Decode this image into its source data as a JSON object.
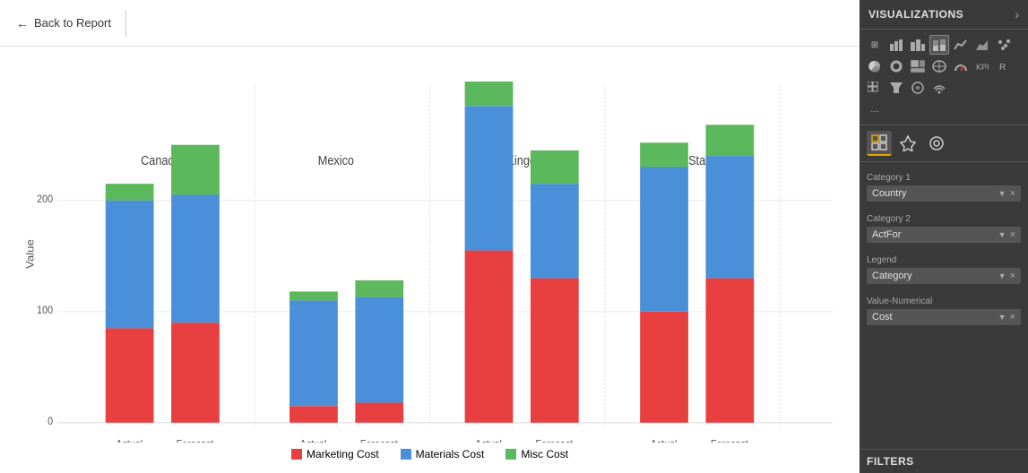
{
  "nav": {
    "back_label": "Back to Report"
  },
  "panel": {
    "title": "VISUALIZATIONS",
    "chevron": "›",
    "tabs": [
      {
        "label": "⊞",
        "icon": "fields-icon",
        "active": true
      },
      {
        "label": "▼",
        "icon": "format-icon",
        "active": false
      },
      {
        "label": "◉",
        "icon": "analytics-icon",
        "active": false
      }
    ],
    "fields": [
      {
        "section_label": "Category 1",
        "pill_text": "Country",
        "has_chevron": true,
        "has_x": true
      },
      {
        "section_label": "Category 2",
        "pill_text": "ActFor",
        "has_chevron": true,
        "has_x": true
      },
      {
        "section_label": "Legend",
        "pill_text": "Category",
        "has_chevron": true,
        "has_x": true
      },
      {
        "section_label": "Value-Numerical",
        "pill_text": "Cost",
        "has_chevron": true,
        "has_x": true
      }
    ],
    "filters_title": "FILTERS"
  },
  "chart": {
    "y_axis_label": "Value",
    "groups": [
      {
        "name": "Canada",
        "bars": [
          {
            "label": "Actual",
            "segments": [
              {
                "color": "#e84040",
                "value": 85
              },
              {
                "color": "#4a90d9",
                "value": 115
              },
              {
                "color": "#5cb85c",
                "value": 15
              }
            ]
          },
          {
            "label": "Forecast",
            "segments": [
              {
                "color": "#e84040",
                "value": 90
              },
              {
                "color": "#4a90d9",
                "value": 115
              },
              {
                "color": "#5cb85c",
                "value": 45
              }
            ]
          }
        ]
      },
      {
        "name": "Mexico",
        "bars": [
          {
            "label": "Actual",
            "segments": [
              {
                "color": "#e84040",
                "value": 15
              },
              {
                "color": "#4a90d9",
                "value": 95
              },
              {
                "color": "#5cb85c",
                "value": 8
              }
            ]
          },
          {
            "label": "Forecast",
            "segments": [
              {
                "color": "#e84040",
                "value": 18
              },
              {
                "color": "#4a90d9",
                "value": 95
              },
              {
                "color": "#5cb85c",
                "value": 15
              }
            ]
          }
        ]
      },
      {
        "name": "United Kingdom",
        "bars": [
          {
            "label": "Actual",
            "segments": [
              {
                "color": "#e84040",
                "value": 155
              },
              {
                "color": "#4a90d9",
                "value": 130
              },
              {
                "color": "#5cb85c",
                "value": 22
              }
            ]
          },
          {
            "label": "Forecast",
            "segments": [
              {
                "color": "#e84040",
                "value": 130
              },
              {
                "color": "#4a90d9",
                "value": 85
              },
              {
                "color": "#5cb85c",
                "value": 30
              }
            ]
          }
        ]
      },
      {
        "name": "United States",
        "bars": [
          {
            "label": "Actual",
            "segments": [
              {
                "color": "#e84040",
                "value": 100
              },
              {
                "color": "#4a90d9",
                "value": 130
              },
              {
                "color": "#5cb85c",
                "value": 22
              }
            ]
          },
          {
            "label": "Forecast",
            "segments": [
              {
                "color": "#e84040",
                "value": 130
              },
              {
                "color": "#4a90d9",
                "value": 110
              },
              {
                "color": "#5cb85c",
                "value": 28
              }
            ]
          }
        ]
      }
    ],
    "y_max": 320,
    "y_ticks": [
      0,
      100,
      200
    ],
    "legend": [
      {
        "label": "Marketing Cost",
        "color": "#e84040"
      },
      {
        "label": "Materials Cost",
        "color": "#4a90d9"
      },
      {
        "label": "Misc Cost",
        "color": "#5cb85c"
      }
    ]
  }
}
